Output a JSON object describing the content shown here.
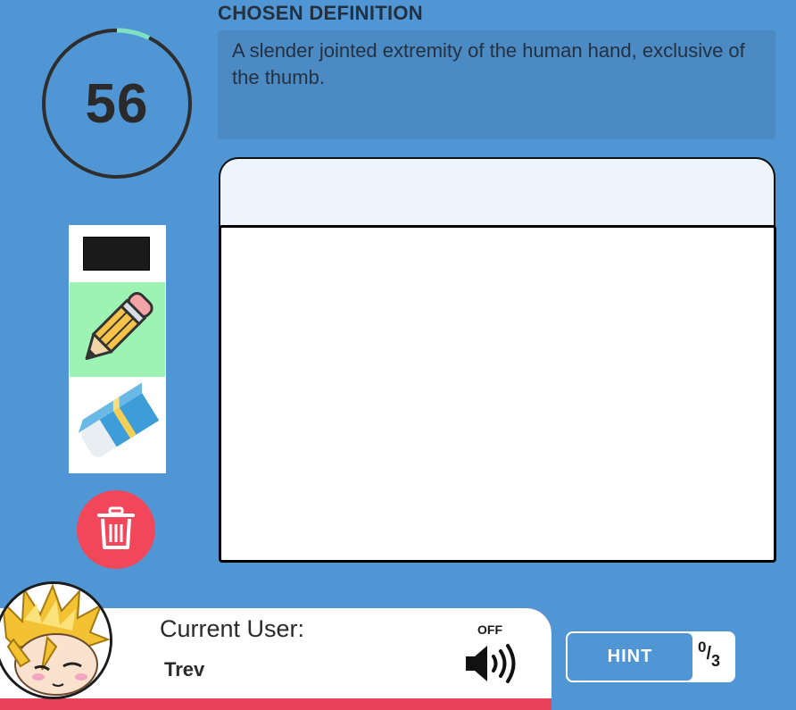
{
  "timer": {
    "value": "56",
    "progress_remaining": 0.93,
    "accent": "#7fe0c4"
  },
  "definition": {
    "heading": "CHOSEN DEFINITION",
    "text": "A slender jointed extremity of the human hand, exclusive of the thumb."
  },
  "tools": {
    "color_swatch": "#1a1a1a",
    "pencil": {
      "icon": "pencil-icon",
      "selected": true
    },
    "eraser": {
      "icon": "eraser-icon",
      "selected": false
    },
    "trash": {
      "icon": "trash-icon",
      "color": "#f2475b"
    }
  },
  "user": {
    "label": "Current User:",
    "name": "Trev",
    "avatar": "super-saiyan-avatar"
  },
  "sound": {
    "state": "OFF",
    "icon": "speaker-icon"
  },
  "hint": {
    "label": "HINT",
    "used": "0",
    "total": "3"
  }
}
